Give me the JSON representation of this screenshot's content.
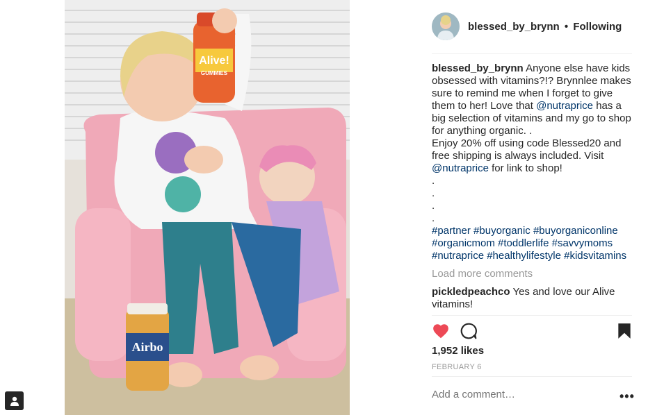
{
  "post": {
    "username": "blessed_by_brynn",
    "separator": "•",
    "follow_status": "Following"
  },
  "caption": {
    "username": "blessed_by_brynn",
    "line1": "Anyone else have kids",
    "line2": "obsessed with vitamins?!? Brynnlee makes",
    "line3": "sure to remind me when I forget to give",
    "line4_pre": "them to her! Love that ",
    "mention1": "@nutraprice",
    "line4_post": " has a",
    "line5": "big selection of vitamins and my go to shop",
    "line6": "for anything organic. .",
    "line7": "Enjoy 20% off using code Blessed20 and",
    "line8": "free shipping is always included. Visit",
    "mention2": "@nutraprice",
    "line9_post": " for link to shop!",
    "dots": [
      ".",
      ".",
      ".",
      "."
    ],
    "hashtags_line1": [
      "#partner",
      "#buyorganic",
      "#buyorganiconline"
    ],
    "hashtags_line2": [
      "#organicmom",
      "#toddlerlife",
      "#savvymoms"
    ],
    "hashtags_line3": [
      "#nutraprice",
      "#healthylifestyle",
      "#kidsvitamins"
    ]
  },
  "load_more_label": "Load more comments",
  "comment": {
    "username": "pickledpeachco",
    "text": "Yes and love our Alive",
    "text2": "vitamins!"
  },
  "actions": {
    "like_icon": "heart-icon",
    "comment_icon": "comment-icon",
    "save_icon": "bookmark-icon",
    "like_color": "#ed4956"
  },
  "likes_text": "1,952 likes",
  "date_text": "FEBRUARY 6",
  "add_comment_placeholder": "Add a comment…",
  "more_label": "•••",
  "photo": {
    "bottle1_label": "Alive!",
    "bottle1_sub": "GUMMIES",
    "bottle2_label": "Airbo"
  }
}
